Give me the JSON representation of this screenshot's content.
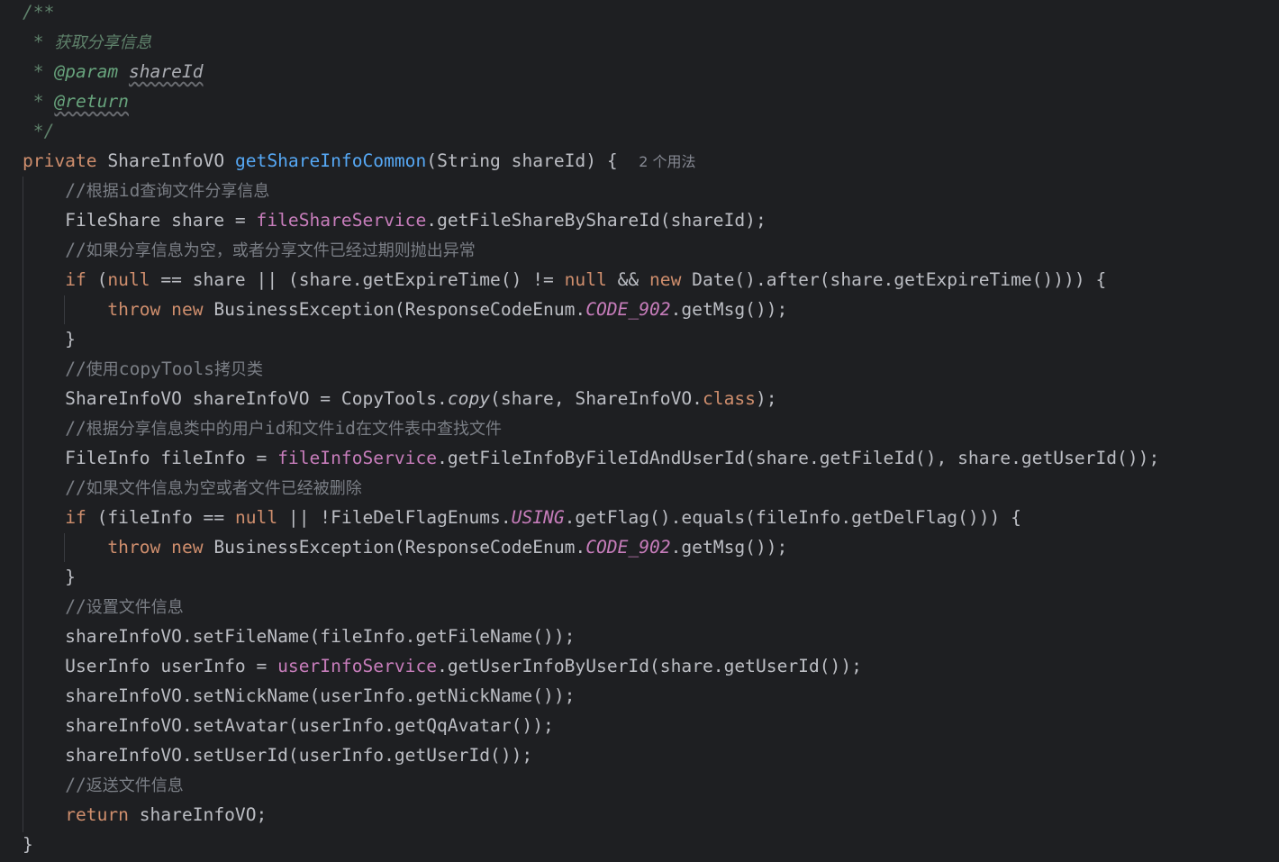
{
  "editor": {
    "language": "Java",
    "theme_colors": {
      "background": "#1e1f22",
      "text": "#bcbec4",
      "keyword": "#cf8e6d",
      "method_declaration": "#56a8f5",
      "field": "#c77dbb",
      "line_comment": "#7a7e85",
      "doc_comment": "#5f826b"
    },
    "lines": [
      [
        [
          "c-doc",
          "/**"
        ]
      ],
      [
        [
          "c-doc",
          " * "
        ],
        [
          "c-doc c-cjk",
          "获取分享信息"
        ]
      ],
      [
        [
          "c-doc",
          " * "
        ],
        [
          "c-doctag",
          "@param"
        ],
        [
          "c-doc",
          " "
        ],
        [
          "c-docparam",
          "shareId"
        ]
      ],
      [
        [
          "c-doc",
          " * "
        ],
        [
          "c-doctag c-doctag-u",
          "@return"
        ]
      ],
      [
        [
          "c-doc",
          " */"
        ]
      ],
      [
        [
          "c-kw",
          "private"
        ],
        [
          "c-plain",
          " ShareInfoVO "
        ],
        [
          "c-fn",
          "getShareInfoCommon"
        ],
        [
          "c-plain",
          "(String shareId) {  "
        ],
        [
          "c-hint",
          "2 个用法"
        ]
      ],
      [
        [
          "c-plain",
          "    "
        ],
        [
          "c-cmt",
          "//"
        ],
        [
          "c-cmt c-cjk",
          "根据"
        ],
        [
          "c-cmt",
          "id"
        ],
        [
          "c-cmt c-cjk",
          "查询文件分享信息"
        ]
      ],
      [
        [
          "c-plain",
          "    FileShare share = "
        ],
        [
          "c-field",
          "fileShareService"
        ],
        [
          "c-plain",
          ".getFileShareByShareId(shareId);"
        ]
      ],
      [
        [
          "c-plain",
          "    "
        ],
        [
          "c-cmt",
          "//"
        ],
        [
          "c-cmt c-cjk",
          "如果分享信息为空，或者分享文件已经过期则抛出异常"
        ]
      ],
      [
        [
          "c-plain",
          "    "
        ],
        [
          "c-kw",
          "if"
        ],
        [
          "c-plain",
          " ("
        ],
        [
          "c-kw",
          "null"
        ],
        [
          "c-plain",
          " == share || (share.getExpireTime() != "
        ],
        [
          "c-kw",
          "null"
        ],
        [
          "c-plain",
          " && "
        ],
        [
          "c-kw",
          "new"
        ],
        [
          "c-plain",
          " Date().after(share.getExpireTime()))) {"
        ]
      ],
      [
        [
          "c-plain",
          "        "
        ],
        [
          "c-kw",
          "throw"
        ],
        [
          "c-plain",
          " "
        ],
        [
          "c-kw",
          "new"
        ],
        [
          "c-plain",
          " BusinessException(ResponseCodeEnum."
        ],
        [
          "c-static",
          "CODE_902"
        ],
        [
          "c-plain",
          ".getMsg());"
        ]
      ],
      [
        [
          "c-plain",
          "    }"
        ]
      ],
      [
        [
          "c-plain",
          "    "
        ],
        [
          "c-cmt",
          "//"
        ],
        [
          "c-cmt c-cjk",
          "使用"
        ],
        [
          "c-cmt",
          "copyTools"
        ],
        [
          "c-cmt c-cjk",
          "拷贝类"
        ]
      ],
      [
        [
          "c-plain",
          "    ShareInfoVO shareInfoVO = CopyTools."
        ],
        [
          "c-plain c-italic",
          "copy"
        ],
        [
          "c-plain",
          "(share, ShareInfoVO."
        ],
        [
          "c-kw",
          "class"
        ],
        [
          "c-plain",
          ");"
        ]
      ],
      [
        [
          "c-plain",
          "    "
        ],
        [
          "c-cmt",
          "//"
        ],
        [
          "c-cmt c-cjk",
          "根据分享信息类中的用户"
        ],
        [
          "c-cmt",
          "id"
        ],
        [
          "c-cmt c-cjk",
          "和文件"
        ],
        [
          "c-cmt",
          "id"
        ],
        [
          "c-cmt c-cjk",
          "在文件表中查找文件"
        ]
      ],
      [
        [
          "c-plain",
          "    FileInfo fileInfo = "
        ],
        [
          "c-field",
          "fileInfoService"
        ],
        [
          "c-plain",
          ".getFileInfoByFileIdAndUserId(share.getFileId(), share.getUserId());"
        ]
      ],
      [
        [
          "c-plain",
          "    "
        ],
        [
          "c-cmt",
          "//"
        ],
        [
          "c-cmt c-cjk",
          "如果文件信息为空或者文件已经被删除"
        ]
      ],
      [
        [
          "c-plain",
          "    "
        ],
        [
          "c-kw",
          "if"
        ],
        [
          "c-plain",
          " (fileInfo == "
        ],
        [
          "c-kw",
          "null"
        ],
        [
          "c-plain",
          " || !FileDelFlagEnums."
        ],
        [
          "c-static",
          "USING"
        ],
        [
          "c-plain",
          ".getFlag().equals(fileInfo.getDelFlag())) {"
        ]
      ],
      [
        [
          "c-plain",
          "        "
        ],
        [
          "c-kw",
          "throw"
        ],
        [
          "c-plain",
          " "
        ],
        [
          "c-kw",
          "new"
        ],
        [
          "c-plain",
          " BusinessException(ResponseCodeEnum."
        ],
        [
          "c-static",
          "CODE_902"
        ],
        [
          "c-plain",
          ".getMsg());"
        ]
      ],
      [
        [
          "c-plain",
          "    }"
        ]
      ],
      [
        [
          "c-plain",
          "    "
        ],
        [
          "c-cmt",
          "//"
        ],
        [
          "c-cmt c-cjk",
          "设置文件信息"
        ]
      ],
      [
        [
          "c-plain",
          "    shareInfoVO.setFileName(fileInfo.getFileName());"
        ]
      ],
      [
        [
          "c-plain",
          "    UserInfo userInfo = "
        ],
        [
          "c-field",
          "userInfoService"
        ],
        [
          "c-plain",
          ".getUserInfoByUserId(share.getUserId());"
        ]
      ],
      [
        [
          "c-plain",
          "    shareInfoVO.setNickName(userInfo.getNickName());"
        ]
      ],
      [
        [
          "c-plain",
          "    shareInfoVO.setAvatar(userInfo.getQqAvatar());"
        ]
      ],
      [
        [
          "c-plain",
          "    shareInfoVO.setUserId(userInfo.getUserId());"
        ]
      ],
      [
        [
          "c-plain",
          "    "
        ],
        [
          "c-cmt",
          "//"
        ],
        [
          "c-cmt c-cjk",
          "返送文件信息"
        ]
      ],
      [
        [
          "c-plain",
          "    "
        ],
        [
          "c-kw",
          "return"
        ],
        [
          "c-plain",
          " shareInfoVO;"
        ]
      ],
      [
        [
          "c-plain",
          "}"
        ]
      ]
    ]
  }
}
